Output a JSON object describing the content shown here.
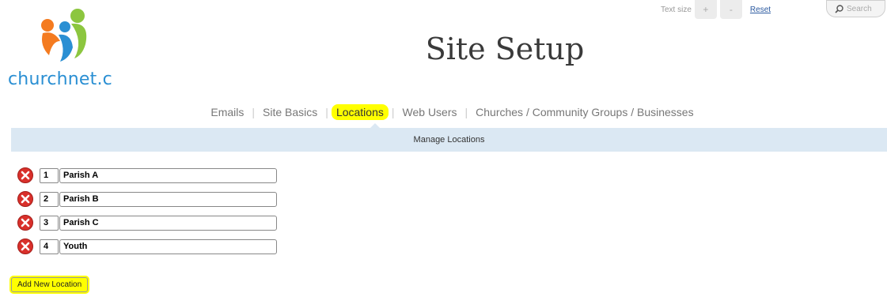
{
  "logo": {
    "text": "churchnet.co"
  },
  "topbar": {
    "text_size_label": "Text size",
    "increase_label": "+",
    "decrease_label": "-",
    "reset_label": "Reset",
    "search_label": "Search"
  },
  "page": {
    "title": "Site Setup"
  },
  "nav": {
    "items": [
      {
        "label": "Emails"
      },
      {
        "label": "Site Basics"
      },
      {
        "label": "Locations",
        "active": true
      },
      {
        "label": "Web Users"
      },
      {
        "label": "Churches / Community Groups / Businesses"
      }
    ]
  },
  "section": {
    "title": "Manage Locations"
  },
  "locations": [
    {
      "order": "1",
      "name": "Parish A"
    },
    {
      "order": "2",
      "name": "Parish B"
    },
    {
      "order": "3",
      "name": "Parish C"
    },
    {
      "order": "4",
      "name": "Youth"
    }
  ],
  "actions": {
    "add_label": "Add New Location"
  },
  "colors": {
    "highlight": "#ffff00",
    "section_bar": "#dbe8f3",
    "delete_icon": "#d9302b"
  }
}
